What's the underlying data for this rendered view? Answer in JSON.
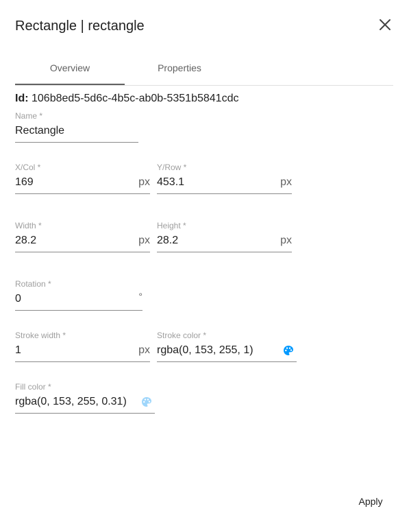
{
  "dialog": {
    "title": "Rectangle | rectangle",
    "close_icon": "close-icon"
  },
  "tabs": [
    {
      "label": "Overview",
      "active": true
    },
    {
      "label": "Properties",
      "active": false
    }
  ],
  "id": {
    "label": "Id:",
    "value": "106b8ed5-5d6c-4b5c-ab0b-5351b5841cdc"
  },
  "fields": {
    "name": {
      "label": "Name *",
      "value": "Rectangle"
    },
    "x": {
      "label": "X/Col *",
      "value": "169",
      "unit": "px"
    },
    "y": {
      "label": "Y/Row *",
      "value": "453.1",
      "unit": "px"
    },
    "width": {
      "label": "Width *",
      "value": "28.2",
      "unit": "px"
    },
    "height": {
      "label": "Height *",
      "value": "28.2",
      "unit": "px"
    },
    "rotation": {
      "label": "Rotation *",
      "value": "0",
      "unit": "°"
    },
    "stroke_width": {
      "label": "Stroke width *",
      "value": "1",
      "unit": "px"
    },
    "stroke_color": {
      "label": "Stroke color *",
      "value": "rgba(0, 153, 255, 1)",
      "swatch": "#0099ff",
      "icon": "palette-icon"
    },
    "fill_color": {
      "label": "Fill color *",
      "value": "rgba(0, 153, 255, 0.31)",
      "swatch": "#9fd6fb",
      "icon": "palette-icon"
    }
  },
  "actions": {
    "apply_label": "Apply"
  }
}
